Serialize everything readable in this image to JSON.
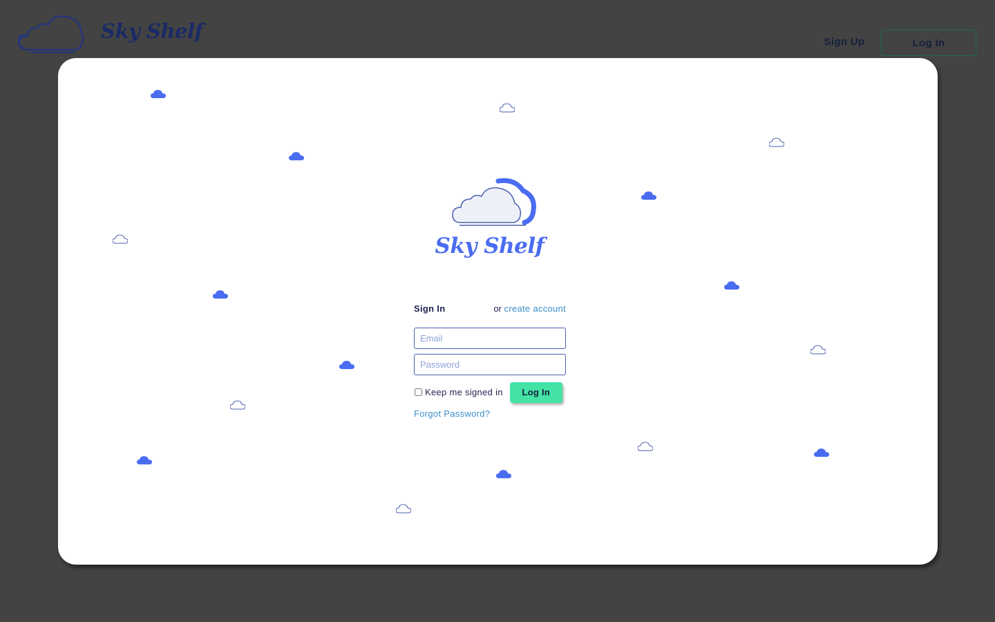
{
  "header": {
    "brand": "Sky Shelf",
    "nav": {
      "signup_label": "Sign Up",
      "login_label": "Log In"
    }
  },
  "modal": {
    "brand": "Sky Shelf",
    "logo_icon": "cloud-logo-icon",
    "form": {
      "title": "Sign In",
      "or_text": "or",
      "create_account_label": "create account",
      "email_placeholder": "Email",
      "password_placeholder": "Password",
      "keep_signed_in_label": "Keep me signed in",
      "keep_signed_in_checked": false,
      "login_button_label": "Log In",
      "forgot_password_label": "Forgot Password?"
    },
    "decorations": {
      "icon": "cloud-icon",
      "filled_color": "#4a6cf0",
      "outline_color": "#4b5fb0"
    }
  },
  "colors": {
    "backdrop": "#434343",
    "brand_blue": "#4a6cf0",
    "accent_green": "#45e2a6",
    "link_blue": "#3b8ec8",
    "text_dark": "#1e2150"
  }
}
